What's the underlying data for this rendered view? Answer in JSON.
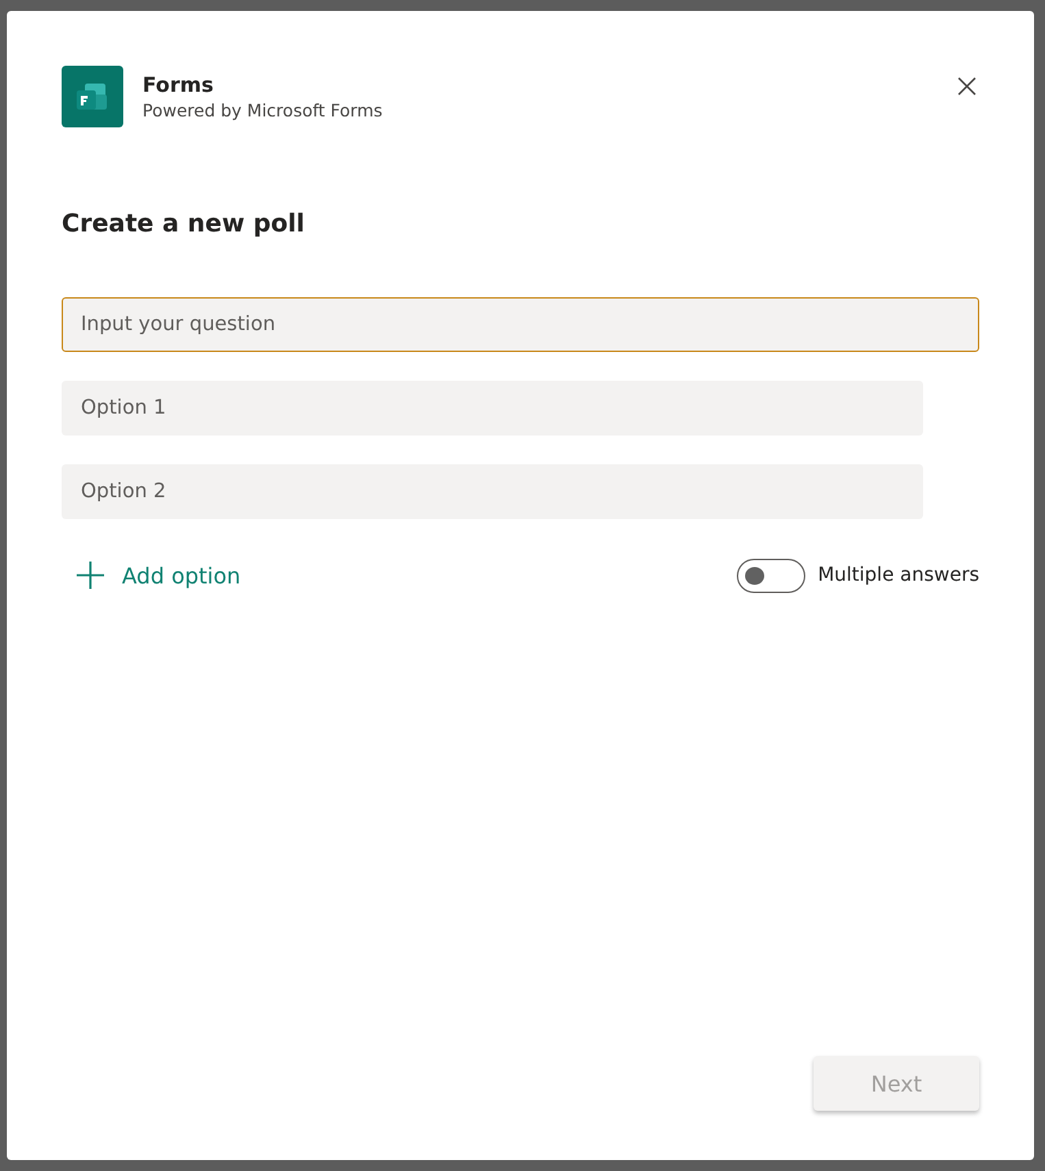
{
  "app": {
    "title": "Forms",
    "subtitle": "Powered by Microsoft Forms"
  },
  "heading": "Create a new poll",
  "question": {
    "placeholder": "Input your question",
    "focused": true
  },
  "options": [
    {
      "placeholder": "Option 1"
    },
    {
      "placeholder": "Option 2"
    }
  ],
  "add_option": {
    "label": "Add option"
  },
  "multiple_answers": {
    "label": "Multiple answers",
    "on": false
  },
  "next": {
    "label": "Next",
    "disabled": true
  }
}
